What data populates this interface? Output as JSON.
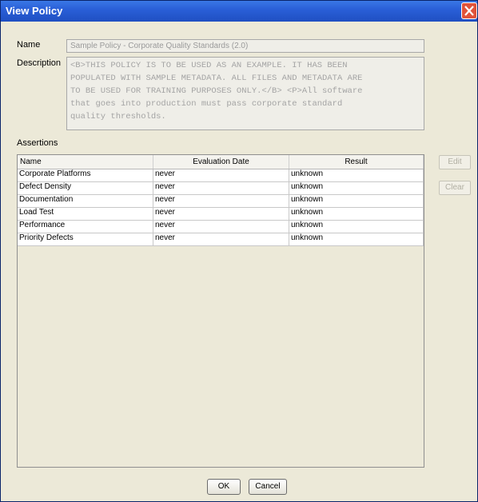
{
  "window": {
    "title": "View Policy"
  },
  "name": {
    "label": "Name",
    "value": "Sample Policy - Corporate Quality Standards (2.0)"
  },
  "description": {
    "label": "Description",
    "lines": [
      "<B>THIS POLICY IS TO BE USED AS AN EXAMPLE. IT HAS BEEN",
      "POPULATED WITH SAMPLE METADATA. ALL FILES AND METADATA ARE",
      "TO BE USED FOR TRAINING PURPOSES ONLY.</B> <P>All software",
      "that goes into production must pass corporate standard",
      "quality thresholds."
    ]
  },
  "assertions": {
    "label": "Assertions",
    "columns": [
      "Name",
      "Evaluation Date",
      "Result"
    ],
    "rows": [
      [
        "Corporate Platforms",
        "never",
        "unknown"
      ],
      [
        "Defect Density",
        "never",
        "unknown"
      ],
      [
        "Documentation",
        "never",
        "unknown"
      ],
      [
        "Load Test",
        "never",
        "unknown"
      ],
      [
        "Performance",
        "never",
        "unknown"
      ],
      [
        "Priority Defects",
        "never",
        "unknown"
      ]
    ]
  },
  "side_buttons": {
    "edit": "Edit",
    "clear": "Clear"
  },
  "footer": {
    "ok": "OK",
    "cancel": "Cancel"
  },
  "icons": {
    "close": "close-icon"
  }
}
